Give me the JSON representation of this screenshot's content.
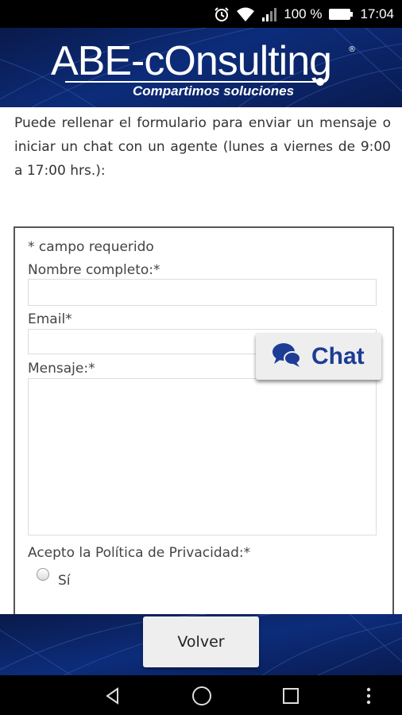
{
  "status_bar": {
    "icons": [
      "alarm-icon",
      "wifi-icon",
      "signal-icon",
      "battery-icon"
    ],
    "battery": "100 %",
    "time": "17:04"
  },
  "header": {
    "logo_text": "ABE-cOnsulting",
    "logo_registered": "®",
    "tagline": "Compartimos soluciones"
  },
  "intro_text": "Puede rellenar el formulario para enviar un mensaje o iniciar un chat con un agente (lunes a viernes de 9:00 a 17:00 hrs.):",
  "form": {
    "required_note": "* campo requerido",
    "name_label": "Nombre completo:*",
    "name_value": "",
    "email_label": "Email*",
    "email_value": "",
    "message_label": "Mensaje:*",
    "message_value": "",
    "privacy_label": "Acepto la Política de Privacidad:*",
    "privacy_option": "Sí"
  },
  "chat_button": {
    "label": "Chat",
    "icon": "chat-bubbles-icon"
  },
  "footer": {
    "back_label": "Volver"
  },
  "nav_bar": {
    "icons": [
      "back-icon",
      "home-icon",
      "recents-icon",
      "overflow-menu-icon"
    ]
  },
  "colors": {
    "brand_dark": "#0a1b50",
    "brand_blue": "#1c3c96",
    "status_bar": "#000000"
  }
}
